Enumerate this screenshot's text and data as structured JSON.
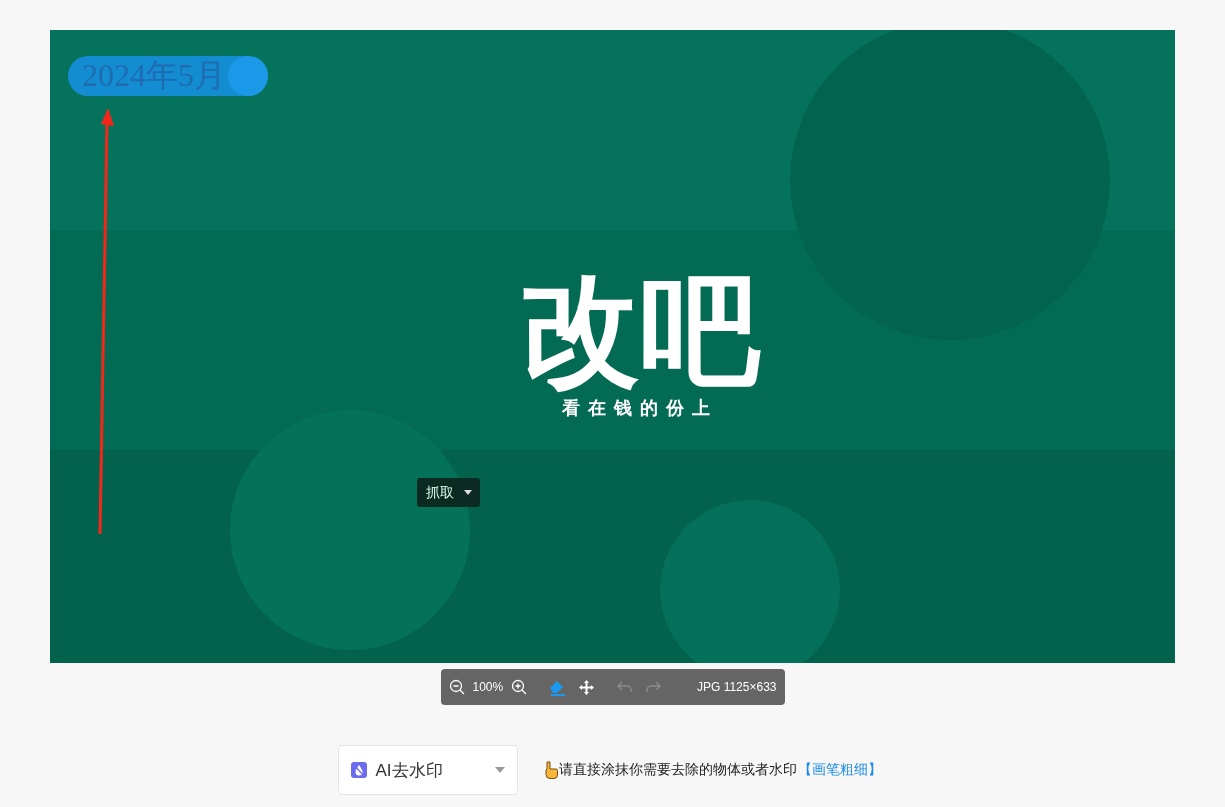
{
  "canvas": {
    "watermark": "2024年5月",
    "poster_title": "改吧",
    "poster_subtitle": "看在钱的份上",
    "grab_button": {
      "label": "抓取"
    }
  },
  "toolbar": {
    "zoom": "100%",
    "tools": [
      {
        "kind": "eraser",
        "selected": true,
        "disabled": false
      },
      {
        "kind": "move",
        "selected": false,
        "disabled": false
      },
      {
        "kind": "undo",
        "disabled": true
      },
      {
        "kind": "redo",
        "disabled": true
      }
    ],
    "image_info": "JPG 1125×633"
  },
  "mode_select": {
    "value": "AI去水印"
  },
  "hint": {
    "text": "请直接涂抹你需要去除的物体或者水印",
    "link": "【画笔粗细】"
  }
}
